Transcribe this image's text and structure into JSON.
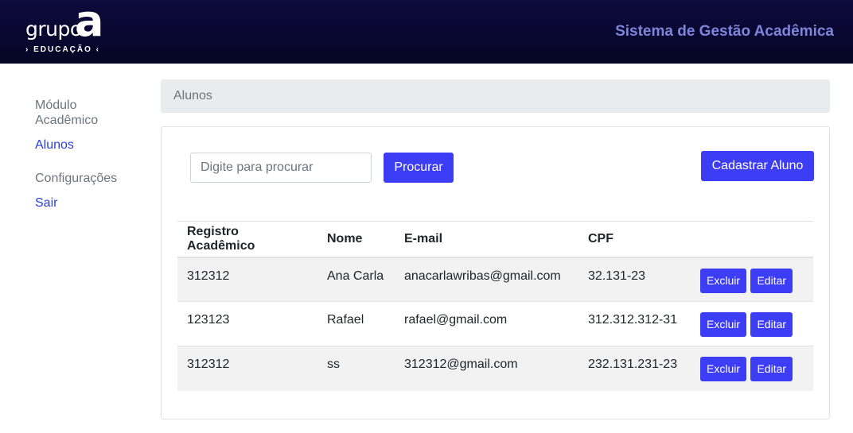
{
  "header": {
    "logo": {
      "word": "grupo",
      "letter": "a",
      "subtitle": "› EDUCAÇÃO ‹"
    },
    "title": "Sistema de Gestão Acadêmica"
  },
  "sidebar": {
    "sections": [
      {
        "heading": "Módulo Acadêmico",
        "links": [
          "Alunos"
        ]
      },
      {
        "heading": "Configurações",
        "links": [
          "Sair"
        ]
      }
    ]
  },
  "breadcrumb": {
    "current": "Alunos"
  },
  "search": {
    "placeholder": "Digite para procurar",
    "value": "",
    "button_label": "Procurar"
  },
  "add_button_label": "Cadastrar Aluno",
  "table": {
    "columns": [
      "Registro Acadêmico",
      "Nome",
      "E-mail",
      "CPF"
    ],
    "rows": [
      {
        "ra": "312312",
        "nome": "Ana Carla",
        "email": "anacarlawribas@gmail.com",
        "cpf": "32.131-23"
      },
      {
        "ra": "123123",
        "nome": "Rafael",
        "email": "rafael@gmail.com",
        "cpf": "312.312.312-31"
      },
      {
        "ra": "312312",
        "nome": "ss",
        "email": "312312@gmail.com",
        "cpf": "232.131.231-23"
      }
    ],
    "delete_label": "Excluir",
    "edit_label": "Editar"
  },
  "colors": {
    "header_bg": "#0b0936",
    "accent": "#3d3df5",
    "title": "#7f84db",
    "link": "#2a3fd6"
  }
}
